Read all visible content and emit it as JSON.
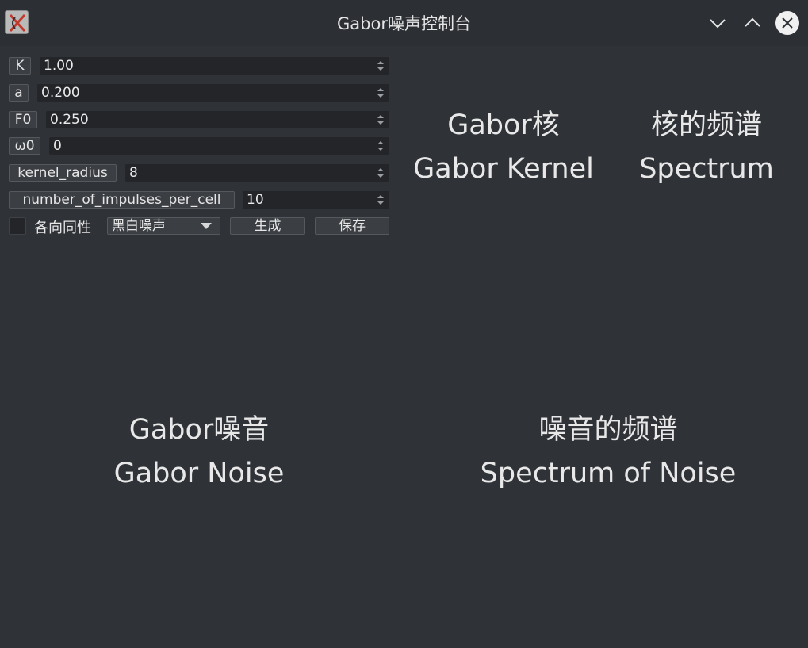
{
  "window": {
    "title": "Gabor噪声控制台",
    "icons": {
      "app": "app-icon",
      "minimize": "chevron-down-icon",
      "maximize": "chevron-up-icon",
      "close": "close-icon"
    }
  },
  "params": {
    "k": {
      "label": "K",
      "value": "1.00"
    },
    "a": {
      "label": "a",
      "value": "0.200"
    },
    "f0": {
      "label": "F0",
      "value": "0.250"
    },
    "omega0": {
      "label": "ω0",
      "value": "0"
    },
    "kernel_radius": {
      "label": "kernel_radius",
      "value": "8"
    },
    "impulses": {
      "label": "number_of_impulses_per_cell",
      "value": "10"
    }
  },
  "controls": {
    "isotropic_label": "各向同性",
    "isotropic_checked": false,
    "noise_type": "黑白噪声",
    "generate_label": "生成",
    "save_label": "保存"
  },
  "panels": {
    "kernel": {
      "line1": "Gabor核",
      "line2": "Gabor Kernel"
    },
    "kernel_spectrum": {
      "line1": "核的频谱",
      "line2": "Spectrum"
    },
    "noise": {
      "line1": "Gabor噪音",
      "line2": "Gabor Noise"
    },
    "noise_spectrum": {
      "line1": "噪音的频谱",
      "line2": "Spectrum of Noise"
    }
  }
}
